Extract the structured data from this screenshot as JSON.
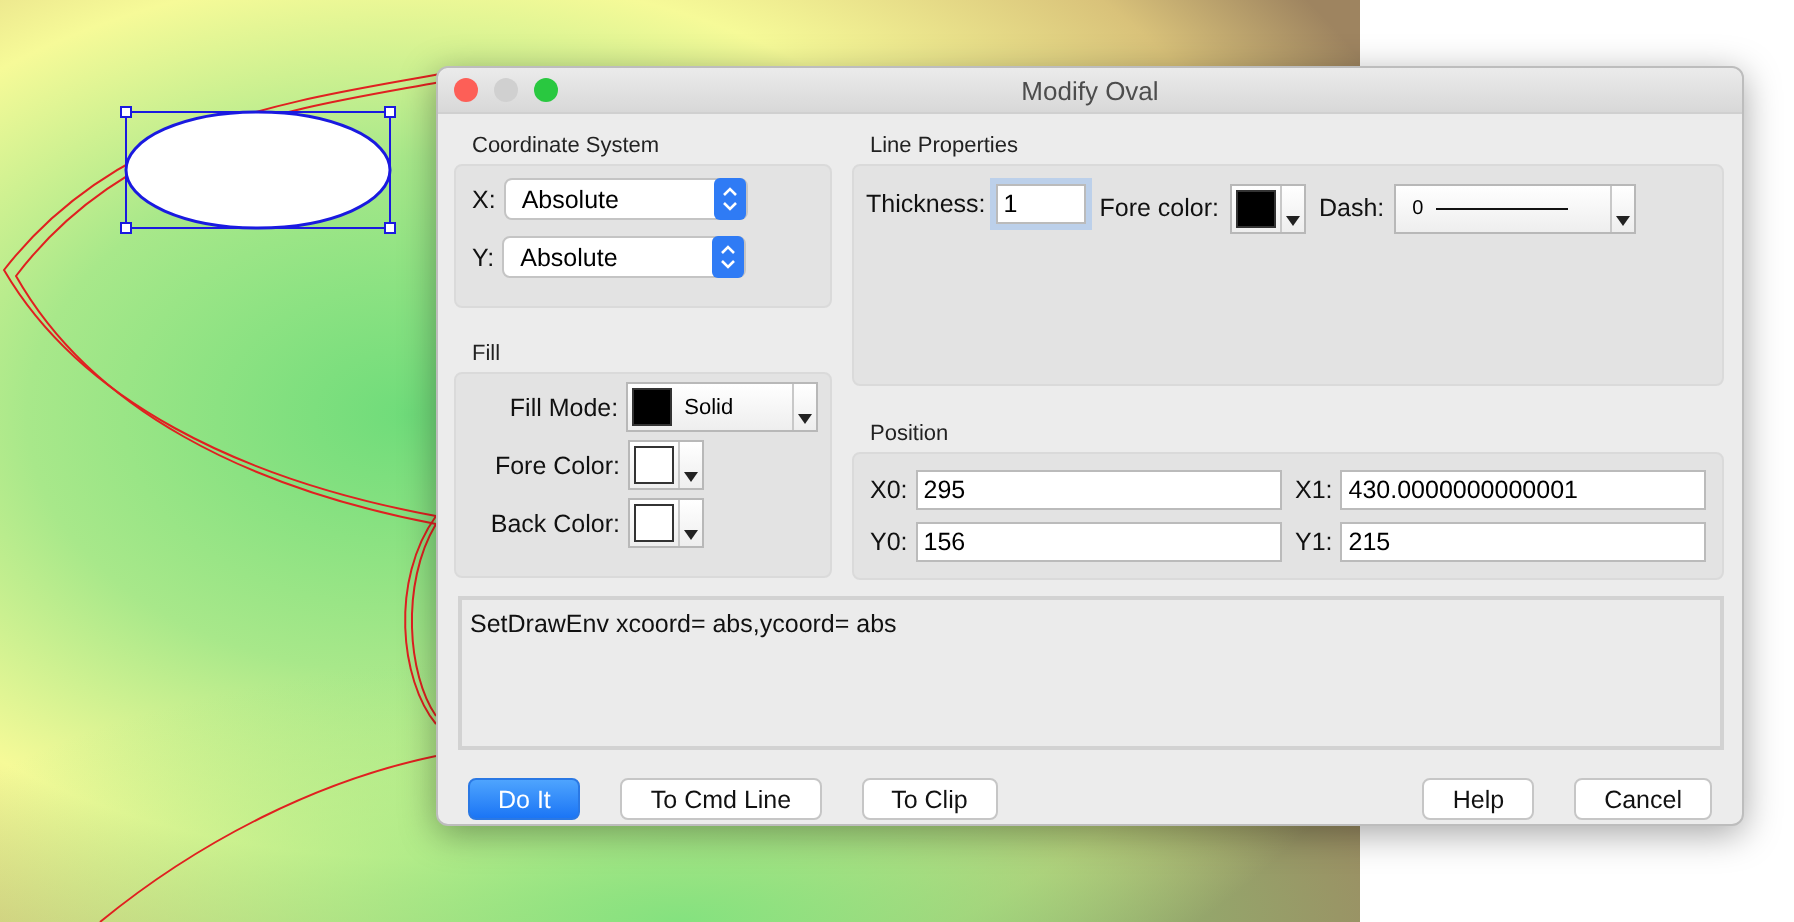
{
  "window": {
    "title": "Modify Oval"
  },
  "coordinate_system": {
    "title": "Coordinate System",
    "fields": [
      {
        "label": "X:",
        "value": "Absolute"
      },
      {
        "label": "Y:",
        "value": "Absolute"
      }
    ]
  },
  "fill": {
    "title": "Fill",
    "fill_mode": {
      "label": "Fill Mode:",
      "value": "Solid",
      "color": "#000000"
    },
    "pickers": [
      {
        "label": "Fore Color:",
        "color": "#ffffff"
      },
      {
        "label": "Back Color:",
        "color": "#ffffff"
      }
    ]
  },
  "line_properties": {
    "title": "Line Properties",
    "thickness": {
      "label": "Thickness:",
      "value": "1"
    },
    "fore_color": {
      "label": "Fore color:",
      "color": "#000000"
    },
    "dash": {
      "label": "Dash:",
      "value": "0"
    }
  },
  "position": {
    "title": "Position",
    "fields": [
      {
        "label": "X0:",
        "value": "295"
      },
      {
        "label": "X1:",
        "value": "430.0000000000001"
      },
      {
        "label": "Y0:",
        "value": "156"
      },
      {
        "label": "Y1:",
        "value": "215"
      }
    ]
  },
  "command": "SetDrawEnv xcoord= abs,ycoord= abs",
  "buttons": [
    {
      "label": "Do It",
      "default": true
    },
    {
      "label": "To Cmd Line",
      "default": false
    },
    {
      "label": "To Clip",
      "default": false
    },
    {
      "label": "Help",
      "default": false
    },
    {
      "label": "Cancel",
      "default": false
    }
  ]
}
